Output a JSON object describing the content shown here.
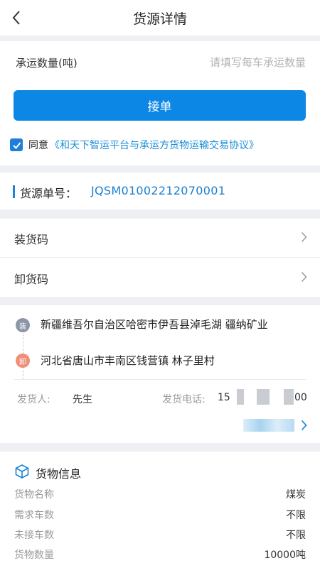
{
  "header": {
    "title": "货源详情"
  },
  "quantity": {
    "label": "承运数量(吨)",
    "value": "",
    "placeholder": "请填写每车承运数量"
  },
  "accept_button": "接单",
  "agreement": {
    "checked": true,
    "prefix": "同意",
    "link": "《和天下智运平台与承运方货物运输交易协议》"
  },
  "order": {
    "label": "货源单号：",
    "value": "JQSM01002212070001"
  },
  "codes": [
    {
      "label": "装货码"
    },
    {
      "label": "卸货码"
    }
  ],
  "route": {
    "load_badge": "装",
    "unload_badge": "卸",
    "load_address": "新疆维吾尔自治区哈密市伊吾县淖毛湖  疆纳矿业",
    "unload_address": "河北省唐山市丰南区钱营镇 林子里村",
    "shipper_label": "发货人:",
    "shipper_name": "先生",
    "phone_label": "发货电话:",
    "phone_prefix": "15",
    "phone_suffix": "00"
  },
  "cargo": {
    "title": "货物信息",
    "rows": [
      {
        "key": "货物名称",
        "value": "煤炭"
      },
      {
        "key": "需求车数",
        "value": "不限"
      },
      {
        "key": "未接车数",
        "value": "不限"
      },
      {
        "key": "货物数量",
        "value": "10000吨"
      }
    ]
  },
  "colors": {
    "accent": "#0d87e6",
    "link": "#1a8fd8",
    "load_badge": "#8d96a8",
    "unload_badge": "#f08f79"
  }
}
